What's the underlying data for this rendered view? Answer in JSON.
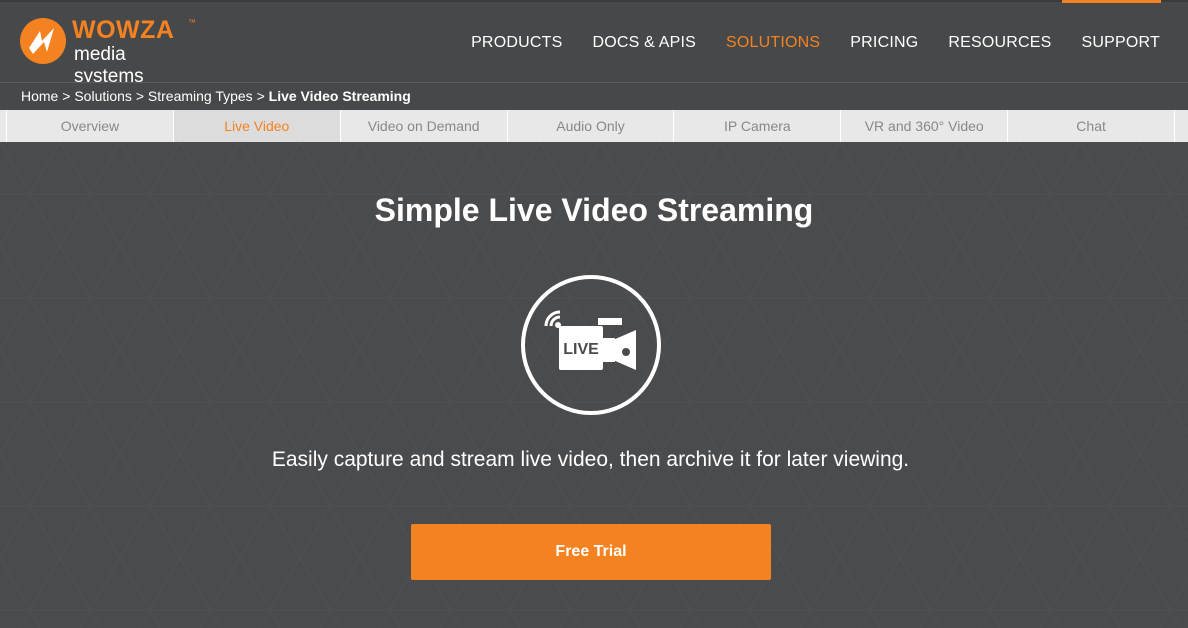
{
  "brand": {
    "name": "WOWZA",
    "tagline": "media systems",
    "trademark": "™",
    "accent_color": "#f58220"
  },
  "nav": {
    "items": [
      {
        "label": "PRODUCTS"
      },
      {
        "label": "DOCS & APIS"
      },
      {
        "label": "SOLUTIONS",
        "active": true
      },
      {
        "label": "PRICING"
      },
      {
        "label": "RESOURCES"
      },
      {
        "label": "SUPPORT"
      }
    ]
  },
  "breadcrumb": {
    "items": [
      "Home",
      "Solutions",
      "Streaming Types"
    ],
    "separator": ">",
    "current": "Live Video Streaming"
  },
  "tabs": [
    {
      "label": "Overview"
    },
    {
      "label": "Live Video",
      "active": true
    },
    {
      "label": "Video on Demand"
    },
    {
      "label": "Audio Only"
    },
    {
      "label": "IP Camera"
    },
    {
      "label": "VR and 360° Video"
    },
    {
      "label": "Chat"
    }
  ],
  "hero": {
    "title": "Simple Live Video Streaming",
    "icon": "live-video-camera-icon",
    "icon_text": "LIVE",
    "subtitle": "Easily capture and stream live video, then archive it for later viewing.",
    "cta_label": "Free Trial"
  }
}
